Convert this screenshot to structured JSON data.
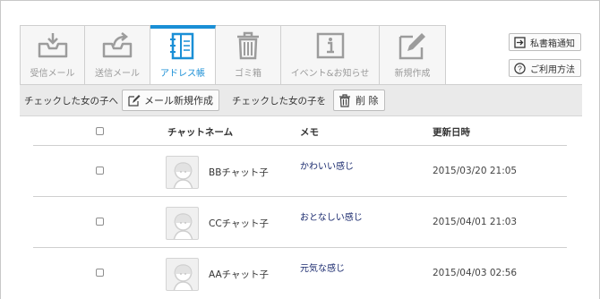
{
  "tabs": [
    {
      "label": "受信メール",
      "icon": "inbox-icon",
      "active": false
    },
    {
      "label": "送信メール",
      "icon": "outbox-icon",
      "active": false
    },
    {
      "label": "アドレス帳",
      "icon": "address-book-icon",
      "active": true
    },
    {
      "label": "ゴミ箱",
      "icon": "trash-icon",
      "active": false
    },
    {
      "label": "イベント&お知らせ",
      "icon": "info-icon",
      "active": false
    },
    {
      "label": "新規作成",
      "icon": "compose-icon",
      "active": false
    }
  ],
  "side_buttons": {
    "notify_label": "私書箱通知",
    "help_label": "ご利用方法"
  },
  "action_bar": {
    "text1": "チェックした女の子へ",
    "new_mail_label": "メール新規作成",
    "text2": "チェックした女の子を",
    "delete_label": "削 除"
  },
  "table": {
    "headers": {
      "name": "チャットネーム",
      "memo": "メモ",
      "date": "更新日時"
    },
    "rows": [
      {
        "name": "BBチャット子",
        "memo": "かわいい感じ",
        "date": "2015/03/20 21:05"
      },
      {
        "name": "CCチャット子",
        "memo": "おとなしい感じ",
        "date": "2015/04/01 21:03"
      },
      {
        "name": "AAチャット子",
        "memo": "元気な感じ",
        "date": "2015/04/03 02:56"
      }
    ]
  },
  "colors": {
    "accent": "#1a8fd6",
    "memo_text": "#1a2a6e",
    "tab_bg": "#f6f6f6"
  }
}
